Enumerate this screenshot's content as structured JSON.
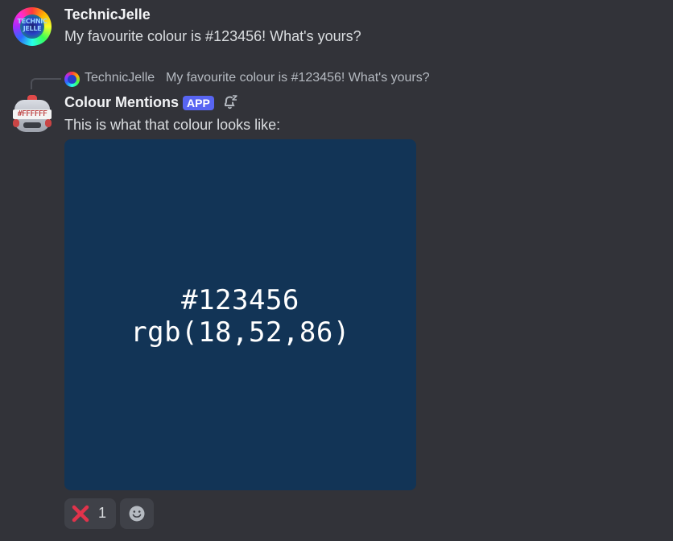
{
  "messages": [
    {
      "author": "TechnicJelle",
      "avatar_text": "TECHNIC JELLE",
      "content": "My favourite colour is #123456! What's yours?"
    },
    {
      "reply_to": {
        "author": "TechnicJelle",
        "content": "My favourite colour is #123456! What's yours?"
      },
      "author": "Colour Mentions",
      "badge": "APP",
      "avatar_text": "#FFFFFF",
      "icon": "muted-bell-icon",
      "content": "This is what that colour looks like:",
      "embed": {
        "background_color": "#123456",
        "hex_label": "#123456",
        "rgb_label": "rgb(18,52,86)"
      },
      "reactions": [
        {
          "emoji": "cross-mark-icon",
          "count": "1"
        }
      ],
      "add_reaction_icon": "add-reaction-icon"
    }
  ],
  "colors": {
    "background": "#323339",
    "username": "#f2f3f5",
    "text": "#dbdee1",
    "muted_text": "#b5bac1",
    "app_badge": "#5865f2",
    "reaction_bg": "#3f4148",
    "cross_mark": "#e0334b"
  }
}
